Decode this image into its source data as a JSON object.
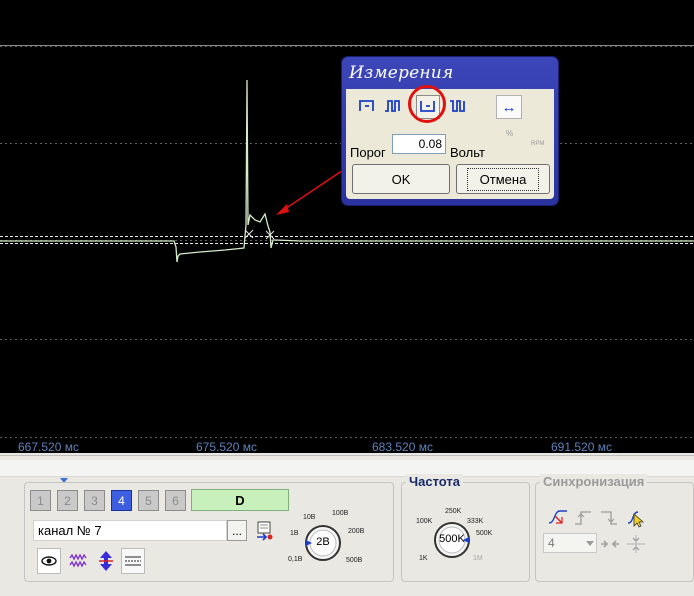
{
  "scope": {
    "background": "#000000",
    "trace_color": "#d4ecc8",
    "time_ticks": [
      "667.520 мс",
      "675.520 мс",
      "683.520 мс",
      "691.520 мс"
    ]
  },
  "dialog": {
    "title": "Измерения",
    "mode_icons": [
      "pulse-high-icon",
      "pulse-train-icon",
      "pulse-low-icon",
      "pulse-pattern-icon"
    ],
    "selected_mode": "pulse-low-icon",
    "direction_icon": "horizontal-arrows-icon",
    "percent_label": "%",
    "rpm_label": "RPM",
    "threshold_label": "Порог",
    "threshold_value": "0.08",
    "unit_label": "Вольт",
    "ok_label": "OK",
    "cancel_label": "Отмена"
  },
  "panel": {
    "channel_buttons": [
      "1",
      "2",
      "3",
      "4",
      "5",
      "6"
    ],
    "active_channel": "4",
    "digital_label": "D",
    "channel_name": "канал № 7",
    "browse_label": "...",
    "voltage_dial": {
      "value": "2В",
      "labels": [
        "0,1В",
        "1В",
        "10В",
        "100В",
        "200В",
        "500В"
      ]
    },
    "frequency": {
      "title": "Частота",
      "value": "500K",
      "labels": [
        "1K",
        "100K",
        "250K",
        "333K",
        "500K",
        "1M"
      ]
    },
    "sync": {
      "title": "Синхронизация",
      "value": "4"
    }
  }
}
